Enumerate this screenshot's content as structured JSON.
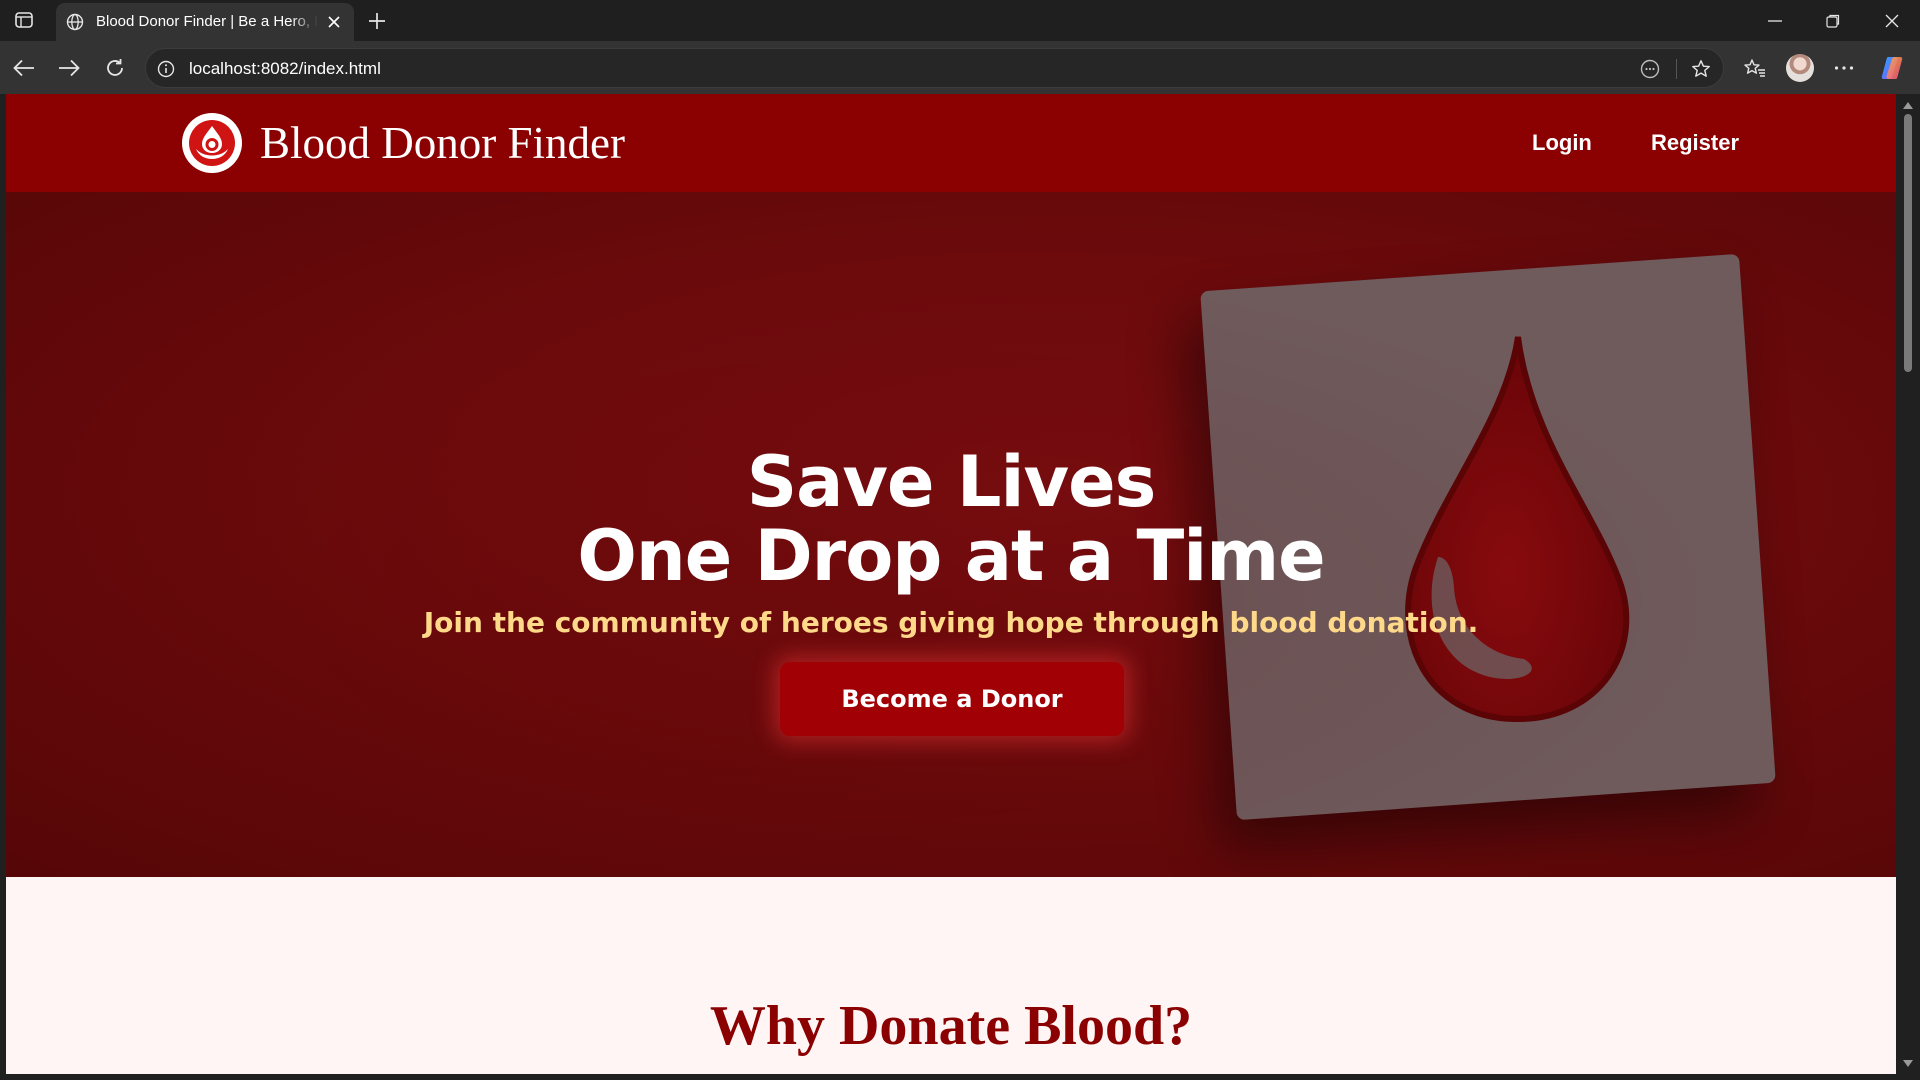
{
  "browser": {
    "tab_title": "Blood Donor Finder | Be a Hero, Donate Blood",
    "url": "localhost:8082/index.html"
  },
  "site": {
    "brand": "Blood Donor Finder",
    "nav": {
      "login": "Login",
      "register": "Register"
    }
  },
  "hero": {
    "title_line1": "Save Lives",
    "title_line2": "One Drop at a Time",
    "subtitle": "Join the community of heroes giving hope through blood donation.",
    "cta": "Become a Donor"
  },
  "sections": {
    "why_title": "Why Donate Blood?"
  },
  "colors": {
    "header": "#8b0000",
    "hero_bg": "#6c0a0c",
    "cta": "#a10005",
    "subtitle": "#ffd98a",
    "page_bg": "#fff5f5"
  },
  "icons": {
    "tab_favicon": "globe-icon",
    "logo": "blood-drop-hands-icon",
    "hero_image": "blood-drop-card-image"
  }
}
